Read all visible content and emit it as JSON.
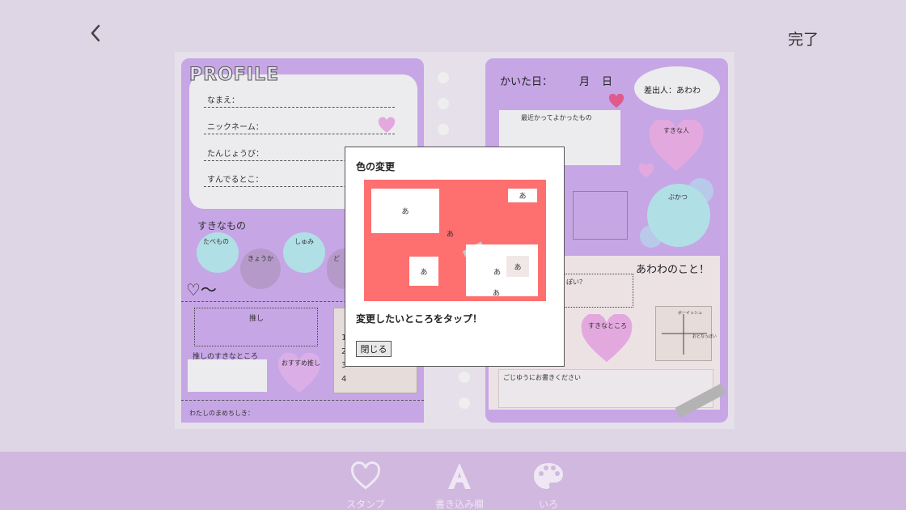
{
  "header": {
    "done_label": "完了"
  },
  "profile": {
    "title": "PROFILE",
    "fields": [
      "なまえ：",
      "ニックネーム：",
      "たんじょうび：",
      "すんでるとこ："
    ],
    "favorites_label": "すきなもの",
    "circles": [
      "たべもの",
      "きょうか",
      "しゅみ",
      "ど"
    ],
    "heart_line": "♡〜",
    "oshi_label": "推し",
    "numbers": [
      "1",
      "2",
      "3",
      "4"
    ],
    "oshi_like_label": "推しのすきなところ",
    "recommend_label": "おすすめ推し",
    "trivia_label": "わたしのまめちしき："
  },
  "right": {
    "date_label": "かいた日：",
    "month": "月",
    "day": "日",
    "sender": "差出人：あわわ",
    "recent_label": "最近かってよかったもの",
    "like_person": "すきな人",
    "club": "ぶかつ",
    "about": "あわわのこと！",
    "question": "ぽい？",
    "like_point": "すきなところ",
    "free_label": "ごじゆうにお書きください",
    "chart_top": "ボーイッシュ",
    "chart_right": "おとなっぽい"
  },
  "modal": {
    "title": "色の変更",
    "preview_char": "あ",
    "message": "変更したいところをタップ！",
    "close_label": "閉じる"
  },
  "toolbar": {
    "stamp": "スタンプ",
    "text": "書き込み欄",
    "color": "いろ"
  },
  "colors": {
    "background": "#ded6e4",
    "panel": "#c7a6e6",
    "preview_red": "#fe6f6f",
    "bottom_bar": "#d1b8df"
  }
}
